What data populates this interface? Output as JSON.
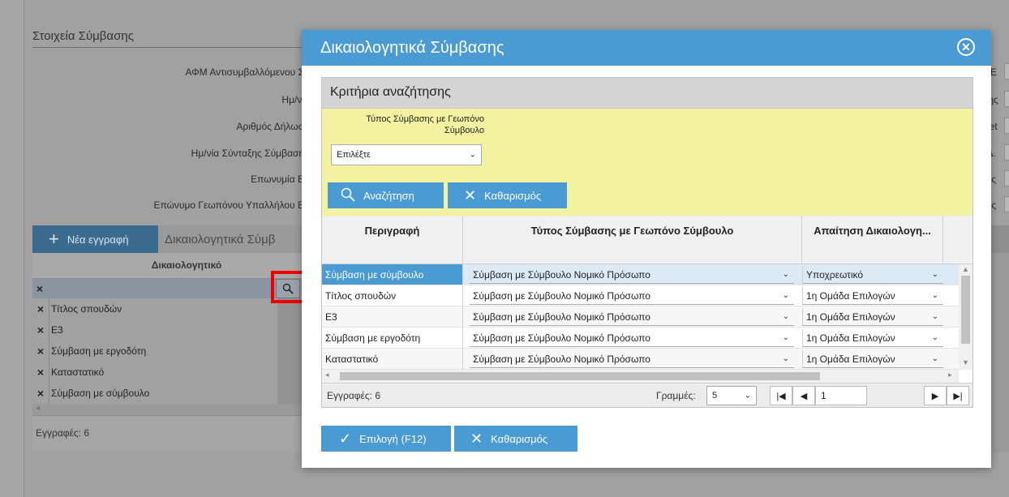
{
  "background": {
    "section_title": "Στοιχεία Σύμβασης",
    "form_labels": [
      "ΑΦΜ Αντισυμβαλλόμενου Σ",
      "Ημ/νί",
      "Αριθμός Δήλωσ",
      "Ημ/νία Σύνταξης Σύμβαση",
      "Επωνυμία Ε",
      "Επώνυμο Γεωπόνου Υπαλλήλου Ε"
    ],
    "right_labels": [
      "ΕΕ",
      "ξης",
      "net",
      ".Δ.",
      "ιης",
      "ιης"
    ],
    "new_record_label": "Νέα εγγραφή",
    "tab_label": "Δικαιολογητικά Σύμβ",
    "column_header": "Δικαιολογητικό",
    "filter_clear": "×",
    "rows": [
      "Τίτλος σπουδών",
      "Ε3",
      "Σύμβαση με εργοδότη",
      "Καταστατικό",
      "Σύμβαση με σύμβουλο"
    ],
    "records_label": "Εγγραφές: 6"
  },
  "modal": {
    "title": "Δικαιολογητικά Σύμβασης",
    "close_icon": "close-circle-icon",
    "criteria": {
      "title": "Κριτήρια αναζήτησης",
      "field_label_line1": "Τύπος Σύμβασης με Γεωπόνο",
      "field_label_line2": "Σύμβουλο",
      "select_value": "Επιλέξτε",
      "search_button": "Αναζήτηση",
      "clear_button": "Καθαρισμός"
    },
    "grid": {
      "columns": [
        "Περιγραφή",
        "Τύπος Σύμβασης με Γεωπόνο Σύμβουλο",
        "Απαίτηση Δικαιολογη..."
      ],
      "rows": [
        {
          "description": "Σύμβαση με σύμβουλο",
          "type": "Σύμβαση με Σύμβουλο Νομικό Πρόσωπο",
          "requirement": "Υποχρεωτικό"
        },
        {
          "description": "Τίτλος σπουδών",
          "type": "Σύμβαση με Σύμβουλο Νομικό Πρόσωπο",
          "requirement": "1η Ομάδα Επιλογών"
        },
        {
          "description": "Ε3",
          "type": "Σύμβαση με Σύμβουλο Νομικό Πρόσωπο",
          "requirement": "1η Ομάδα Επιλογών"
        },
        {
          "description": "Σύμβαση με εργοδότη",
          "type": "Σύμβαση με Σύμβουλο Νομικό Πρόσωπο",
          "requirement": "1η Ομάδα Επιλογών"
        },
        {
          "description": "Καταστατικό",
          "type": "Σύμβαση με Σύμβουλο Νομικό Πρόσωπο",
          "requirement": "1η Ομάδα Επιλογών"
        }
      ],
      "records_label": "Εγγραφές: 6",
      "rows_label": "Γραμμές:",
      "rows_value": "5",
      "page_value": "1"
    },
    "select_button": "Επιλογή (F12)",
    "clear_button": "Καθαρισμός"
  }
}
